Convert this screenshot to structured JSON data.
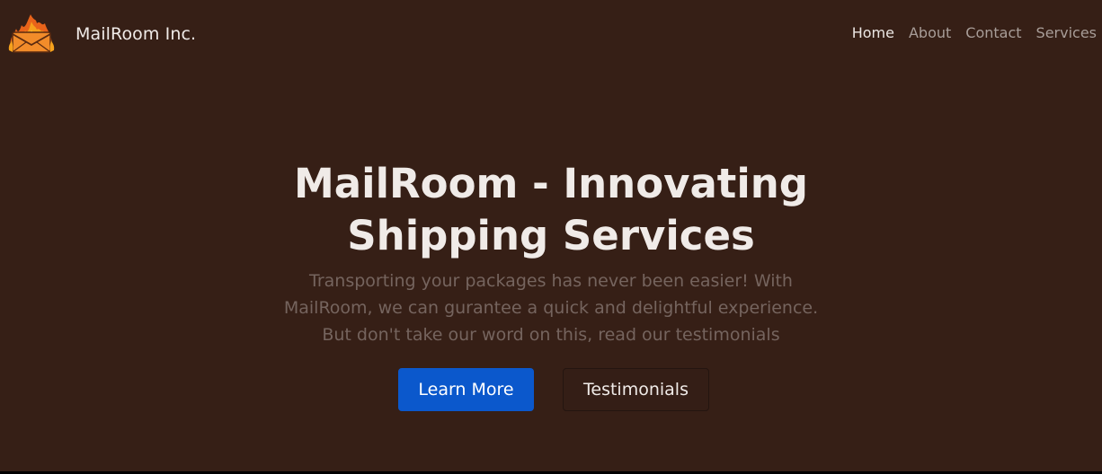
{
  "brand": {
    "name": "MailRoom Inc."
  },
  "nav": {
    "items": [
      {
        "label": "Home",
        "active": true
      },
      {
        "label": "About",
        "active": false
      },
      {
        "label": "Contact",
        "active": false
      },
      {
        "label": "Services",
        "active": false
      }
    ]
  },
  "hero": {
    "title_line1": "MailRoom - Innovating",
    "title_line2": "Shipping Services",
    "text": "Transporting your packages has never been easier! With MailRoom, we can gurantee a quick and delightful experience. But don't take our word on this, read our testimonials",
    "primary_button": "Learn More",
    "secondary_button": "Testimonials"
  },
  "colors": {
    "background": "#361f16",
    "primary_button": "#0b58cc",
    "muted_text": "#75645e"
  },
  "icons": {
    "logo": "flaming-envelope-icon"
  }
}
